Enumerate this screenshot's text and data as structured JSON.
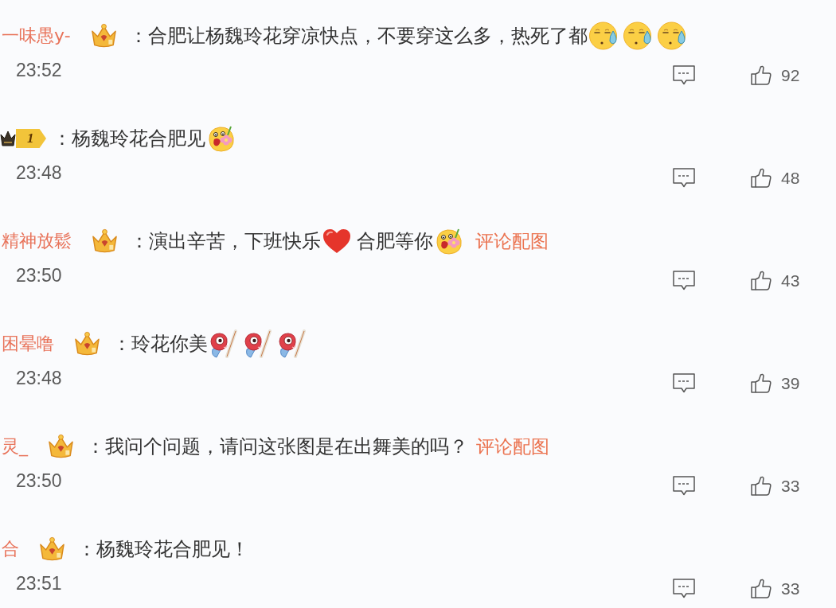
{
  "comments": [
    {
      "username": "一味愚y-",
      "badge": {
        "kind": "crown"
      },
      "content": [
        {
          "kind": "text",
          "text": "：合肥让杨魏玲花穿凉快点，不要穿这么多，热死了都"
        },
        {
          "kind": "sweat"
        },
        {
          "kind": "sweat"
        },
        {
          "kind": "sweat"
        }
      ],
      "time": "23:52",
      "likes": "92"
    },
    {
      "badge": {
        "kind": "level",
        "text": "1"
      },
      "content": [
        {
          "kind": "text",
          "text": "：杨魏玲花合肥见"
        },
        {
          "kind": "flower"
        }
      ],
      "time": "23:48",
      "likes": "48"
    },
    {
      "username": "精神放鬆",
      "badge": {
        "kind": "crown"
      },
      "content": [
        {
          "kind": "text",
          "text": "：演出辛苦，下班快乐"
        },
        {
          "kind": "heart"
        },
        {
          "kind": "text",
          "text": "合肥等你"
        },
        {
          "kind": "flower"
        },
        {
          "kind": "link",
          "text": "评论配图"
        }
      ],
      "time": "23:50",
      "likes": "43"
    },
    {
      "username": "困晕噜",
      "badge": {
        "kind": "crown"
      },
      "content": [
        {
          "kind": "text",
          "text": "：玲花你美"
        },
        {
          "kind": "fish"
        },
        {
          "kind": "fish"
        },
        {
          "kind": "fish"
        }
      ],
      "time": "23:48",
      "likes": "39"
    },
    {
      "username": "灵_",
      "badge": {
        "kind": "crown"
      },
      "content": [
        {
          "kind": "text",
          "text": "：我问个问题，请问这张图是在出舞美的吗？"
        },
        {
          "kind": "link",
          "text": "评论配图"
        }
      ],
      "time": "23:50",
      "likes": "33"
    },
    {
      "username": "合",
      "badge": {
        "kind": "crown"
      },
      "content": [
        {
          "kind": "text",
          "text": "：杨魏玲花合肥见！"
        }
      ],
      "time": "23:51",
      "likes": "33"
    }
  ]
}
